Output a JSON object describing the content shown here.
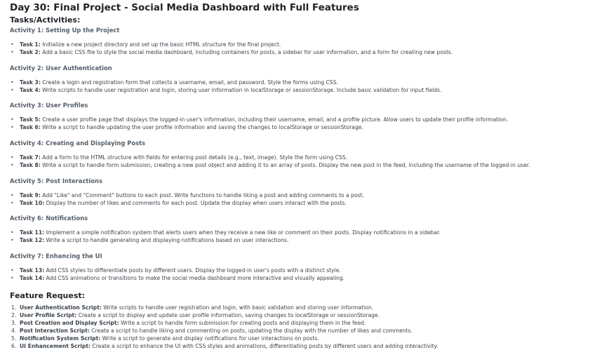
{
  "title": "Day 30: Final Project - Social Media Dashboard with Full Features",
  "tasks_heading": "Tasks/Activities:",
  "activities": [
    {
      "heading": "Activity 1: Setting Up the Project",
      "tasks": [
        {
          "label": "Task 1:",
          "text": " Initialize a new project directory and set up the basic HTML structure for the final project."
        },
        {
          "label": "Task 2:",
          "text": " Add a basic CSS file to style the social media dashboard, including containers for posts, a sidebar for user information, and a form for creating new posts."
        }
      ]
    },
    {
      "heading": "Activity 2: User Authentication",
      "tasks": [
        {
          "label": "Task 3:",
          "text": " Create a login and registration form that collects a username, email, and password. Style the forms using CSS."
        },
        {
          "label": "Task 4:",
          "text": " Write scripts to handle user registration and login, storing user information in localStorage or sessionStorage. Include basic validation for input fields."
        }
      ]
    },
    {
      "heading": "Activity 3: User Profiles",
      "tasks": [
        {
          "label": "Task 5:",
          "text": " Create a user profile page that displays the logged-in user's information, including their username, email, and a profile picture. Allow users to update their profile information."
        },
        {
          "label": "Task 6:",
          "text": " Write a script to handle updating the user profile information and saving the changes to localStorage or sessionStorage."
        }
      ]
    },
    {
      "heading": "Activity 4: Creating and Displaying Posts",
      "tasks": [
        {
          "label": "Task 7:",
          "text": " Add a form to the HTML structure with fields for entering post details (e.g., text, image). Style the form using CSS."
        },
        {
          "label": "Task 8:",
          "text": " Write a script to handle form submission, creating a new post object and adding it to an array of posts. Display the new post in the feed, including the username of the logged-in user."
        }
      ]
    },
    {
      "heading": "Activity 5: Post Interactions",
      "tasks": [
        {
          "label": "Task 9:",
          "text": " Add \"Like\" and \"Comment\" buttons to each post. Write functions to handle liking a post and adding comments to a post."
        },
        {
          "label": "Task 10:",
          "text": " Display the number of likes and comments for each post. Update the display when users interact with the posts."
        }
      ]
    },
    {
      "heading": "Activity 6: Notifications",
      "tasks": [
        {
          "label": "Task 11:",
          "text": " Implement a simple notification system that alerts users when they receive a new like or comment on their posts. Display notifications in a sidebar."
        },
        {
          "label": "Task 12:",
          "text": " Write a script to handle generating and displaying notifications based on user interactions."
        }
      ]
    },
    {
      "heading": "Activity 7: Enhancing the UI",
      "tasks": [
        {
          "label": "Task 13:",
          "text": " Add CSS styles to differentiate posts by different users. Display the logged-in user's posts with a distinct style."
        },
        {
          "label": "Task 14:",
          "text": " Add CSS animations or transitions to make the social media dashboard more interactive and visually appealing."
        }
      ]
    }
  ],
  "feature_heading": "Feature Request:",
  "features": [
    {
      "num": "1.",
      "label": "User Authentication Script:",
      "text": " Write scripts to handle user registration and login, with basic validation and storing user information."
    },
    {
      "num": "2.",
      "label": "User Profile Script:",
      "text": " Create a script to display and update user profile information, saving changes to localStorage or sessionStorage."
    },
    {
      "num": "3.",
      "label": "Post Creation and Display Script:",
      "text": " Write a script to handle form submission for creating posts and displaying them in the feed."
    },
    {
      "num": "4.",
      "label": "Post Interaction Script:",
      "text": " Create a script to handle liking and commenting on posts, updating the display with the number of likes and comments."
    },
    {
      "num": "5.",
      "label": "Notification System Script:",
      "text": " Write a script to generate and display notifications for user interactions on posts."
    },
    {
      "num": "6.",
      "label": "UI Enhancement Script:",
      "text": " Create a script to enhance the UI with CSS styles and animations, differentiating posts by different users and adding interactivity."
    }
  ]
}
